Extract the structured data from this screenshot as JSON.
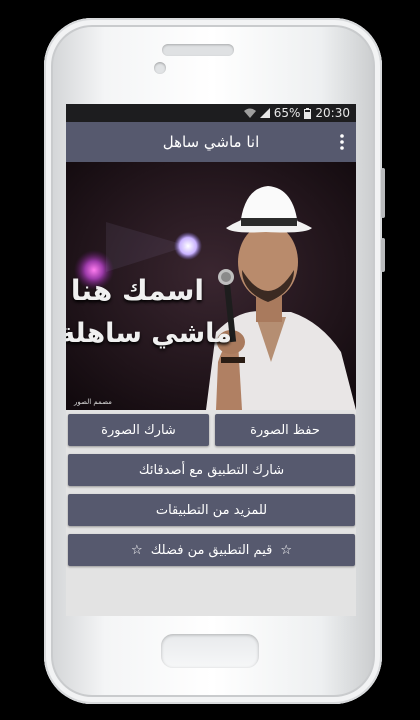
{
  "status_bar": {
    "battery_percent": "65%",
    "time": "20:30"
  },
  "toolbar": {
    "title": "انا ماشي ساهل"
  },
  "banner": {
    "line1": "اسمك هنا",
    "line2": "ماشي ساهلة",
    "watermark": "مصمم الصور"
  },
  "buttons": {
    "save_image": "حفظ الصورة",
    "share_image": "شارك الصورة",
    "share_app": "شارك التطبيق مع أصدقائك",
    "more_apps": "للمزيد من التطبيقات",
    "rate_app": "قيم التطبيق من فضلك",
    "star": "☆"
  },
  "colors": {
    "toolbar": "#56596e",
    "button": "#56596e",
    "screen_bg": "#e3e3e3"
  }
}
